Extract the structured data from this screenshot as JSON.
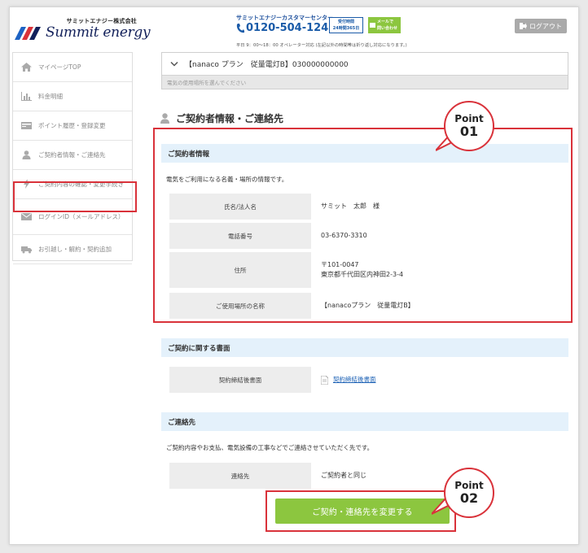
{
  "header": {
    "logo_jp": "サミットエナジー株式会社",
    "logo_en": "Summit energy",
    "cc_title": "サミットエナジーカスタマーセンター",
    "cc_phone": "0120-504-124",
    "cc_hours_line1": "受付時間",
    "cc_hours_line2": "24時間365日",
    "cc_mail_line1": "メールで",
    "cc_mail_line2": "問い合わせ",
    "cc_note": "平日 9：00～18：00 オペレーター対応 (左記以外の時間帯は折り返し対応になります。)",
    "logout_label": "ログアウト"
  },
  "sidebar": {
    "items": [
      {
        "label": "マイページTOP",
        "icon": "home-icon"
      },
      {
        "label": "料金明細",
        "icon": "bar-chart-icon"
      },
      {
        "label": "ポイント履歴・登録変更",
        "icon": "card-icon"
      },
      {
        "label": "ご契約者情報・ご連絡先",
        "icon": "person-icon"
      },
      {
        "label": "ご契約内容の確認・変更手続き",
        "icon": "lightning-icon"
      },
      {
        "label": "ログインID（メールアドレス）",
        "icon": "mail-icon"
      },
      {
        "label": "お引越し・解約・契約追加",
        "icon": "truck-icon"
      }
    ]
  },
  "contract_select": {
    "value": "【nanaco プラン　従量電灯B】030000000000",
    "hint": "電気の使用場所を選んでください"
  },
  "page_title": "ご契約者情報・ご連絡先",
  "contractor": {
    "heading": "ご契約者情報",
    "description": "電気をご利用になる名義・場所の情報です。",
    "rows": [
      {
        "key": "氏名/法人名",
        "value": "サミット　太郎　様"
      },
      {
        "key": "電話番号",
        "value": "03-6370-3310"
      },
      {
        "key": "住所",
        "value_line1": "〒101-0047",
        "value_line2": "東京都千代田区内神田2-3-4"
      },
      {
        "key": "ご使用場所の名称",
        "value": "【nanacoプラン　従量電灯B】"
      }
    ]
  },
  "documents": {
    "heading": "ご契約に関する書面",
    "row_key": "契約締結後書面",
    "row_link": "契約締結後書面"
  },
  "contact": {
    "heading": "ご連絡先",
    "description": "ご契約内容やお支払、電気設備の工事などでご連絡させていただく先です。",
    "row_key": "連絡先",
    "row_value": "ご契約者と同じ"
  },
  "change_button": "ご契約・連絡先を変更する",
  "points": [
    {
      "word": "Point",
      "num": "01"
    },
    {
      "word": "Point",
      "num": "02"
    }
  ],
  "colors": {
    "accent_green": "#8cc63f",
    "highlight_red": "#d9323a",
    "section_blue": "#e4f1fb",
    "link_blue": "#1f63b6",
    "brand_navy": "#12205a"
  }
}
